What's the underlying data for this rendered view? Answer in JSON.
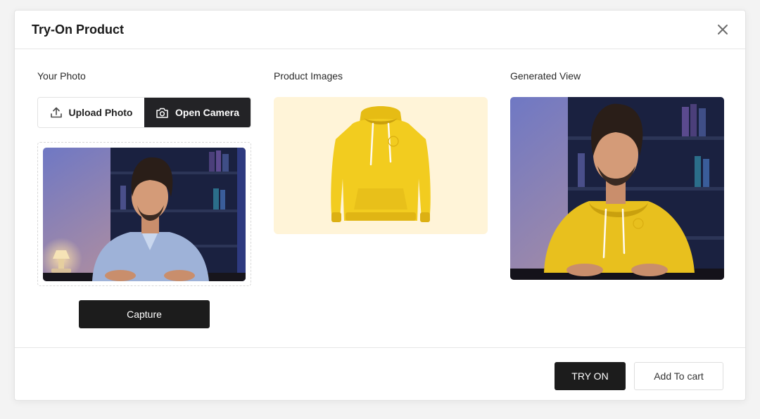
{
  "modal": {
    "title": "Try-On Product"
  },
  "your_photo": {
    "label": "Your Photo",
    "upload_label": "Upload Photo",
    "camera_label": "Open Camera",
    "capture_label": "Capture"
  },
  "product": {
    "label": "Product Images"
  },
  "generated": {
    "label": "Generated View"
  },
  "footer": {
    "try_on_label": "TRY ON",
    "add_to_cart_label": "Add To cart"
  },
  "icons": {
    "close": "close-icon",
    "upload": "upload-icon",
    "camera": "camera-icon"
  },
  "colors": {
    "primary_dark": "#1c1c1c",
    "product_bg": "#fff4d8",
    "hoodie_yellow": "#f2cc1f"
  }
}
